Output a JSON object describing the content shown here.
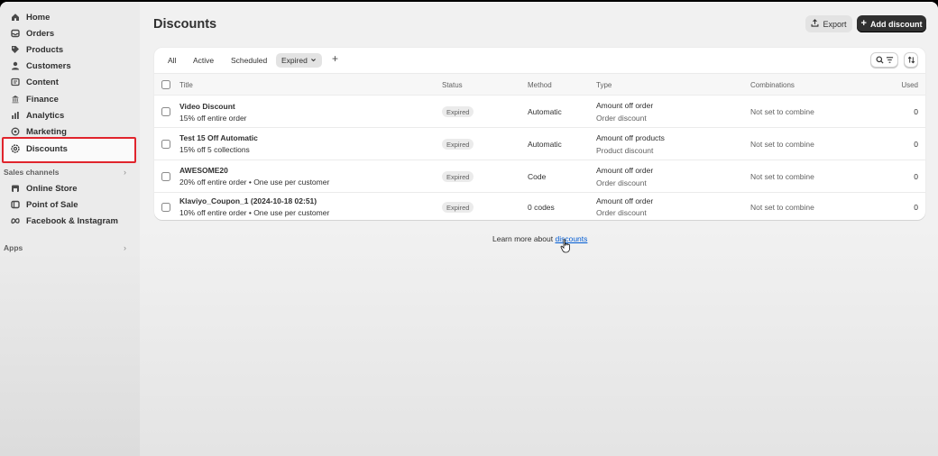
{
  "sidebar": {
    "items": [
      {
        "label": "Home",
        "icon": "home-icon"
      },
      {
        "label": "Orders",
        "icon": "inbox-icon"
      },
      {
        "label": "Products",
        "icon": "tag-icon"
      },
      {
        "label": "Customers",
        "icon": "person-icon"
      },
      {
        "label": "Content",
        "icon": "content-icon"
      },
      {
        "label": "Finance",
        "icon": "bank-icon"
      },
      {
        "label": "Analytics",
        "icon": "bar-chart-icon"
      },
      {
        "label": "Marketing",
        "icon": "target-icon"
      },
      {
        "label": "Discounts",
        "icon": "discount-gear-icon"
      }
    ],
    "sales_channels_label": "Sales channels",
    "channels": [
      {
        "label": "Online Store",
        "icon": "store-icon"
      },
      {
        "label": "Point of Sale",
        "icon": "pos-icon"
      },
      {
        "label": "Facebook & Instagram",
        "icon": "meta-icon"
      }
    ],
    "apps_label": "Apps"
  },
  "page": {
    "title": "Discounts",
    "export_label": "Export",
    "add_label": "Add discount"
  },
  "tabs": [
    {
      "label": "All"
    },
    {
      "label": "Active"
    },
    {
      "label": "Scheduled"
    },
    {
      "label": "Expired",
      "selected": true
    }
  ],
  "columns": [
    "Title",
    "Status",
    "Method",
    "Type",
    "Combinations",
    "Used"
  ],
  "rows": [
    {
      "title": "Video Discount",
      "subtitle": "15% off entire order",
      "status": "Expired",
      "method": "Automatic",
      "type": "Amount off order",
      "type_sub": "Order discount",
      "combinations": "Not set to combine",
      "used": "0"
    },
    {
      "title": "Test 15 Off Automatic",
      "subtitle": "15% off 5 collections",
      "status": "Expired",
      "method": "Automatic",
      "type": "Amount off products",
      "type_sub": "Product discount",
      "combinations": "Not set to combine",
      "used": "0"
    },
    {
      "title": "AWESOME20",
      "subtitle": "20% off entire order • One use per customer",
      "status": "Expired",
      "method": "Code",
      "type": "Amount off order",
      "type_sub": "Order discount",
      "combinations": "Not set to combine",
      "used": "0"
    },
    {
      "title": "Klaviyo_Coupon_1 (2024-10-18 02:51)",
      "subtitle": "10% off entire order • One use per customer",
      "status": "Expired",
      "method": "0 codes",
      "type": "Amount off order",
      "type_sub": "Order discount",
      "combinations": "Not set to combine",
      "used": "0"
    }
  ],
  "footer": {
    "prefix": "Learn more about",
    "link": "discounts"
  },
  "colors": {
    "accent_dark": "#303030",
    "link": "#005bd3",
    "highlight": "#e0242c"
  }
}
